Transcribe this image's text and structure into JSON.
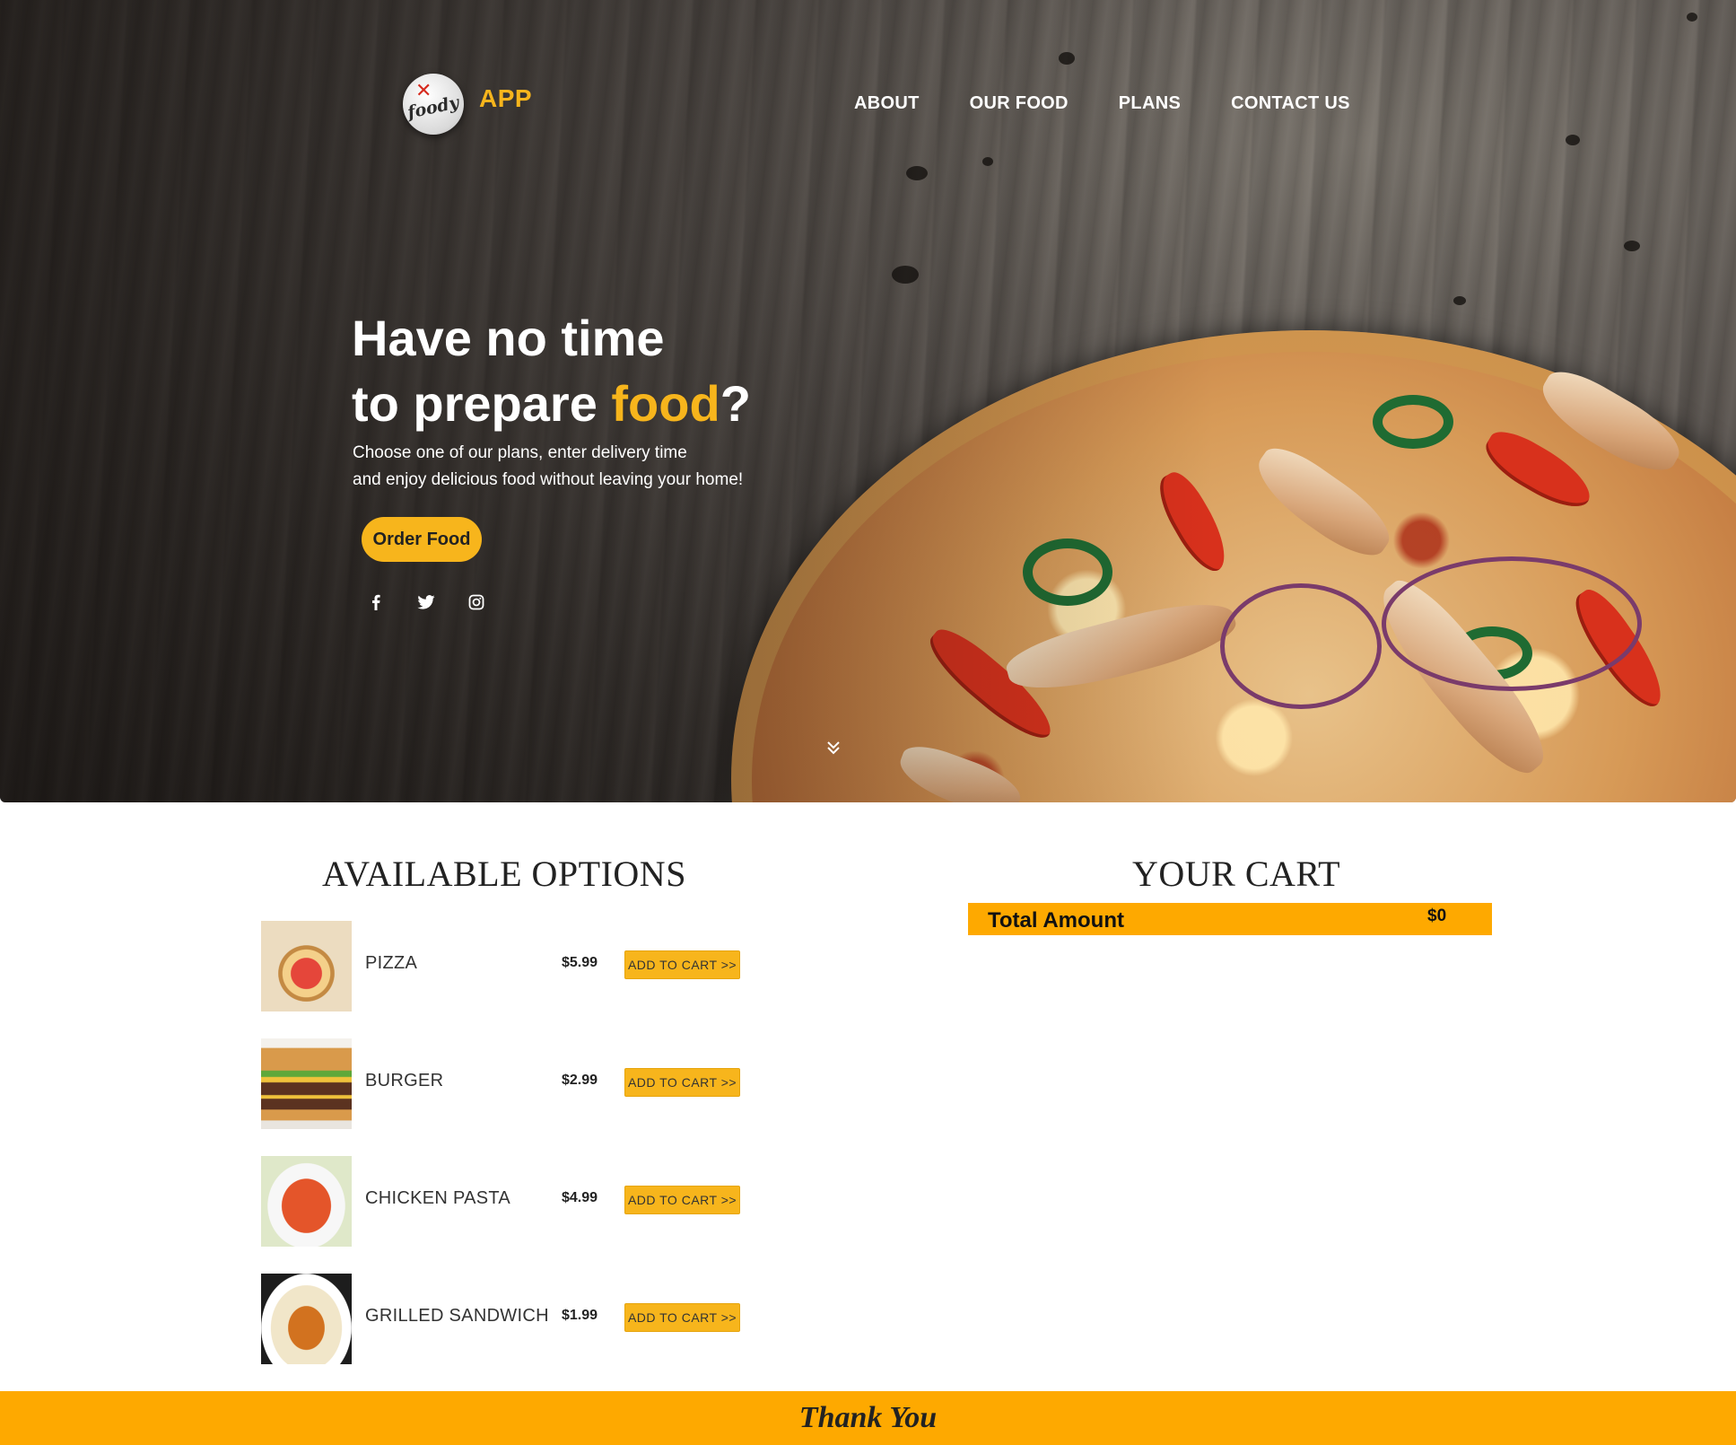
{
  "brand": {
    "logo_text": "foody",
    "app_label": "APP"
  },
  "nav": {
    "items": [
      "ABOUT",
      "OUR FOOD",
      "PLANS",
      "CONTACT US"
    ]
  },
  "hero": {
    "headline_line1": "Have no time",
    "headline_line2_prefix": "to prepare ",
    "headline_accent": "food",
    "headline_suffix": "?",
    "sub_line1": "Choose one of our plans, enter delivery time",
    "sub_line2": "and enjoy delicious food without leaving your home!",
    "cta_label": "Order Food",
    "social_icons": [
      "facebook-icon",
      "twitter-icon",
      "instagram-icon"
    ]
  },
  "options": {
    "title": "AVAILABLE OPTIONS",
    "items": [
      {
        "name": "PIZZA",
        "price": "$5.99",
        "button": "ADD TO CART >>"
      },
      {
        "name": "BURGER",
        "price": "$2.99",
        "button": "ADD TO CART >>"
      },
      {
        "name": "CHICKEN PASTA",
        "price": "$4.99",
        "button": "ADD TO CART >>"
      },
      {
        "name": "GRILLED SANDWICH",
        "price": "$1.99",
        "button": "ADD TO CART >>"
      }
    ]
  },
  "cart": {
    "title": "YOUR CART",
    "total_label": "Total Amount",
    "total_value": "$0"
  },
  "footer": {
    "text": "Thank You"
  },
  "colors": {
    "accent": "#f7b51c",
    "cart_bar": "#fea900",
    "footer": "#fea900"
  }
}
